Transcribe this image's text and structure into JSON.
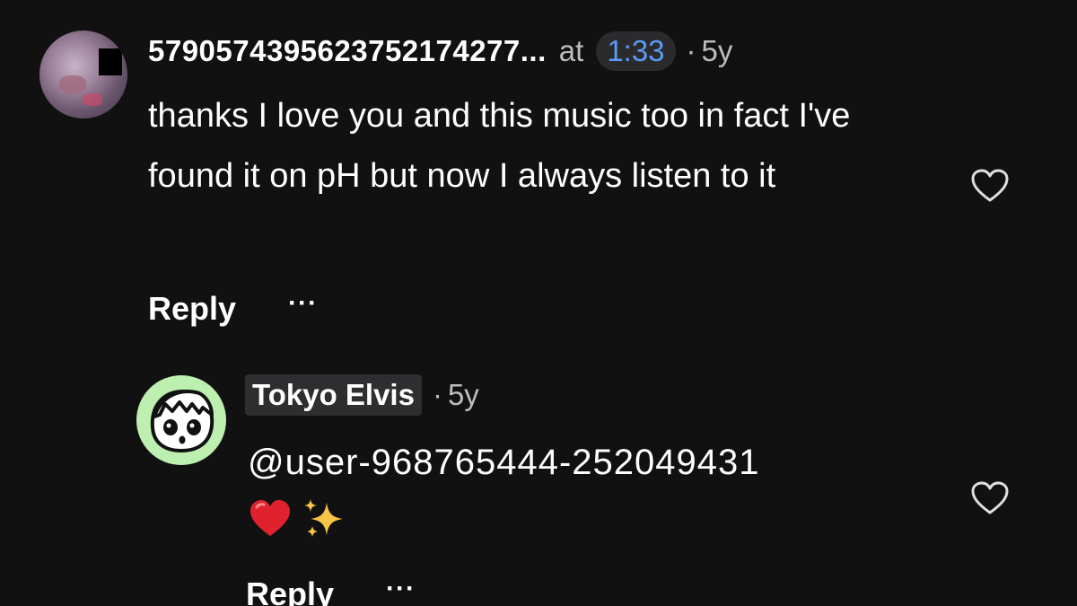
{
  "comments": [
    {
      "author": "579057439562375217427​7...",
      "at_label": "at",
      "timestamp": "1:33",
      "dot": "·",
      "age": "5y",
      "text": "thanks I love you and this music too in fact I've found it on pH but now I always listen to it",
      "reply_label": "Reply",
      "more_label": "···"
    },
    {
      "author": "Tokyo Elvis",
      "dot": "·",
      "age": "5y",
      "text": "@user-968765444-252049431",
      "emojis": [
        "red-heart-emoji",
        "sparkles-emoji"
      ],
      "reply_label": "Reply",
      "more_label": "···"
    }
  ],
  "colors": {
    "background": "#111111",
    "timestamp_link": "#5a9cf6",
    "secondary_text": "#bdbdbd",
    "avatar_green": "#bdf0b0"
  },
  "icons": {
    "like": "heart-outline-icon"
  }
}
